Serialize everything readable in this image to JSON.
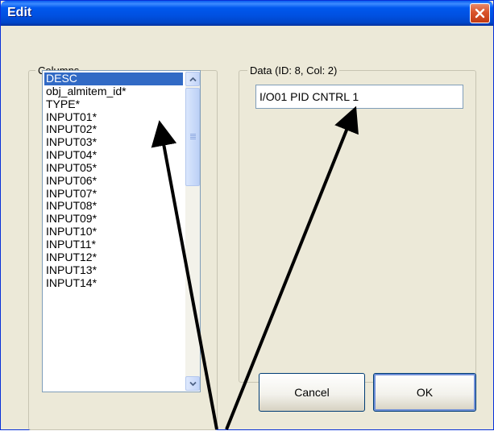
{
  "window": {
    "title": "Edit"
  },
  "columns_group": {
    "legend": "Columns",
    "selected_index": 0,
    "items": [
      "DESC",
      "obj_almitem_id*",
      "TYPE*",
      "INPUT01*",
      "INPUT02*",
      "INPUT03*",
      "INPUT04*",
      "INPUT05*",
      "INPUT06*",
      "INPUT07*",
      "INPUT08*",
      "INPUT09*",
      "INPUT10*",
      "INPUT11*",
      "INPUT12*",
      "INPUT13*",
      "INPUT14*"
    ]
  },
  "data_group": {
    "legend": "Data (ID: 8, Col: 2)",
    "value": "I/O01 PID CNTRL 1"
  },
  "buttons": {
    "cancel": "Cancel",
    "ok": "OK"
  },
  "icons": {
    "close": "close-icon",
    "scroll_up": "chevron-up-icon",
    "scroll_down": "chevron-down-icon"
  },
  "colors": {
    "title_bar": "#0054e3",
    "selection": "#316ac5",
    "close_button": "#d9532b"
  }
}
